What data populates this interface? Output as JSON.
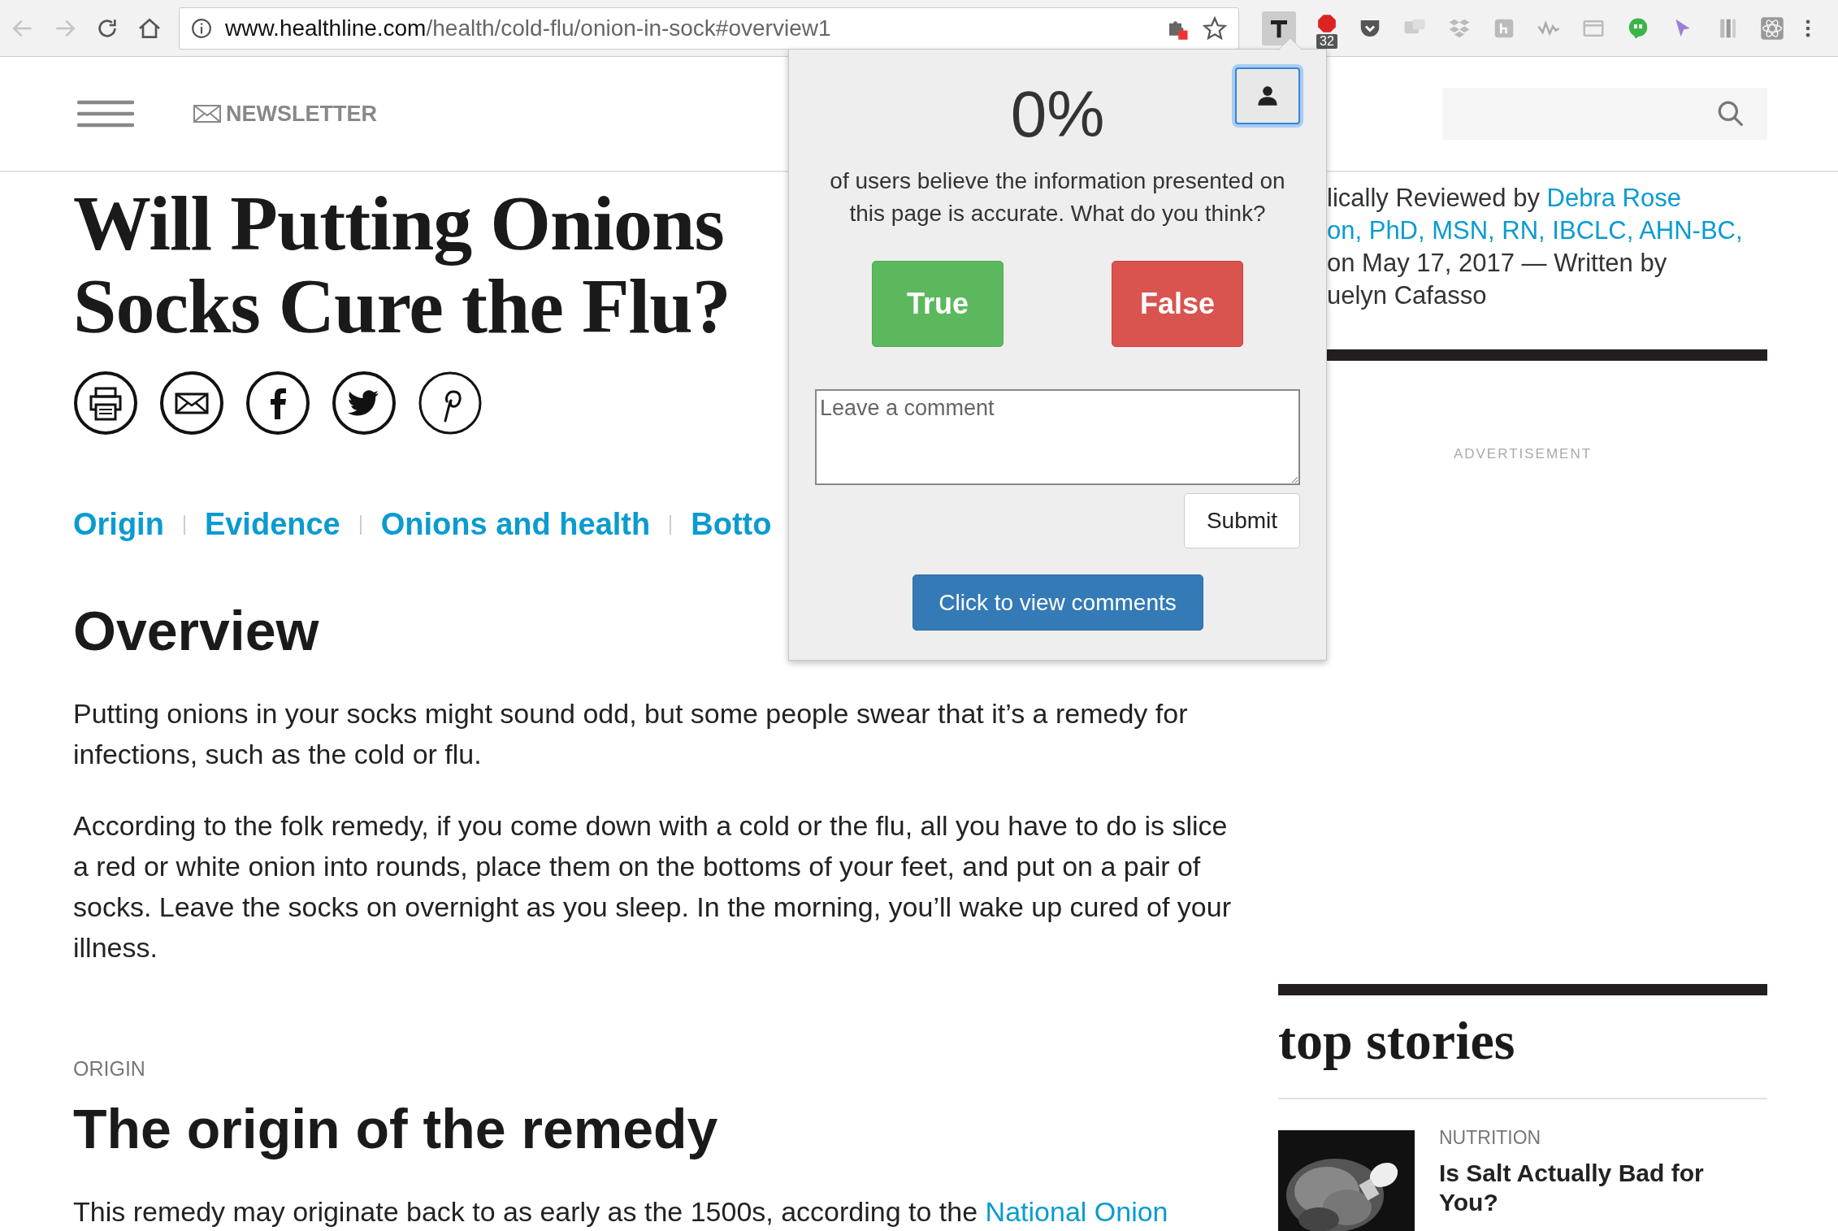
{
  "browser": {
    "url_host": "www.healthline.com",
    "url_path": "/health/cold-flu/onion-in-sock#overview1",
    "badge": "32"
  },
  "header": {
    "newsletter": "NEWSLETTER"
  },
  "article": {
    "title_lines": [
      "Will Putting Onions",
      "Socks Cure the Flu?"
    ],
    "nav_links": [
      "Origin",
      "Evidence",
      "Onions and health",
      "Botto"
    ],
    "overview": {
      "heading": "Overview",
      "paragraphs": [
        [
          {
            "kind": "text",
            "text": "Putting onions in your socks might sound odd, but some people swear that it’s a remedy for infections, such as the cold or flu."
          }
        ],
        [
          {
            "kind": "text",
            "text": "According to the folk remedy, if you come down with a cold or the flu, all you have to do is slice a red or white onion into rounds, place them on the bottoms of your feet, and put on a pair of socks. Leave the socks on overnight as you sleep. In the morning, you’ll wake up cured of your illness."
          }
        ]
      ]
    },
    "origin": {
      "eyebrow": "ORIGIN",
      "heading": "The origin of the remedy",
      "paragraphs": [
        [
          {
            "kind": "text",
            "text": "This remedy may originate back to as early as the 1500s, according to the "
          },
          {
            "kind": "link",
            "text": "National Onion"
          }
        ]
      ]
    }
  },
  "popup": {
    "percent": "0%",
    "message": "of users believe the information presented on this page is accurate. What do you think?",
    "votes": [
      {
        "label": "True",
        "kind": "true"
      },
      {
        "label": "False",
        "kind": "false"
      }
    ],
    "comment": {
      "placeholder": "Leave a comment"
    },
    "submit": "Submit",
    "view_comments": "Click to view comments"
  },
  "sidebar": {
    "byline": [
      [
        {
          "kind": "text",
          "text": "lically Reviewed by "
        },
        {
          "kind": "link",
          "text": "Debra Rose"
        }
      ],
      [
        {
          "kind": "link",
          "text": "on, PhD, MSN, RN, IBCLC, AHN-BC,"
        }
      ],
      [
        {
          "kind": "text",
          "text": "on May 17, 2017 — Written by"
        }
      ],
      [
        {
          "kind": "text",
          "text": "uelyn Cafasso"
        }
      ]
    ],
    "advertisement": "ADVERTISEMENT",
    "top_stories": "top stories",
    "stories": [
      {
        "kind": "picture",
        "category": "NUTRITION",
        "title": "Is Salt Actually Bad for You?"
      }
    ]
  }
}
